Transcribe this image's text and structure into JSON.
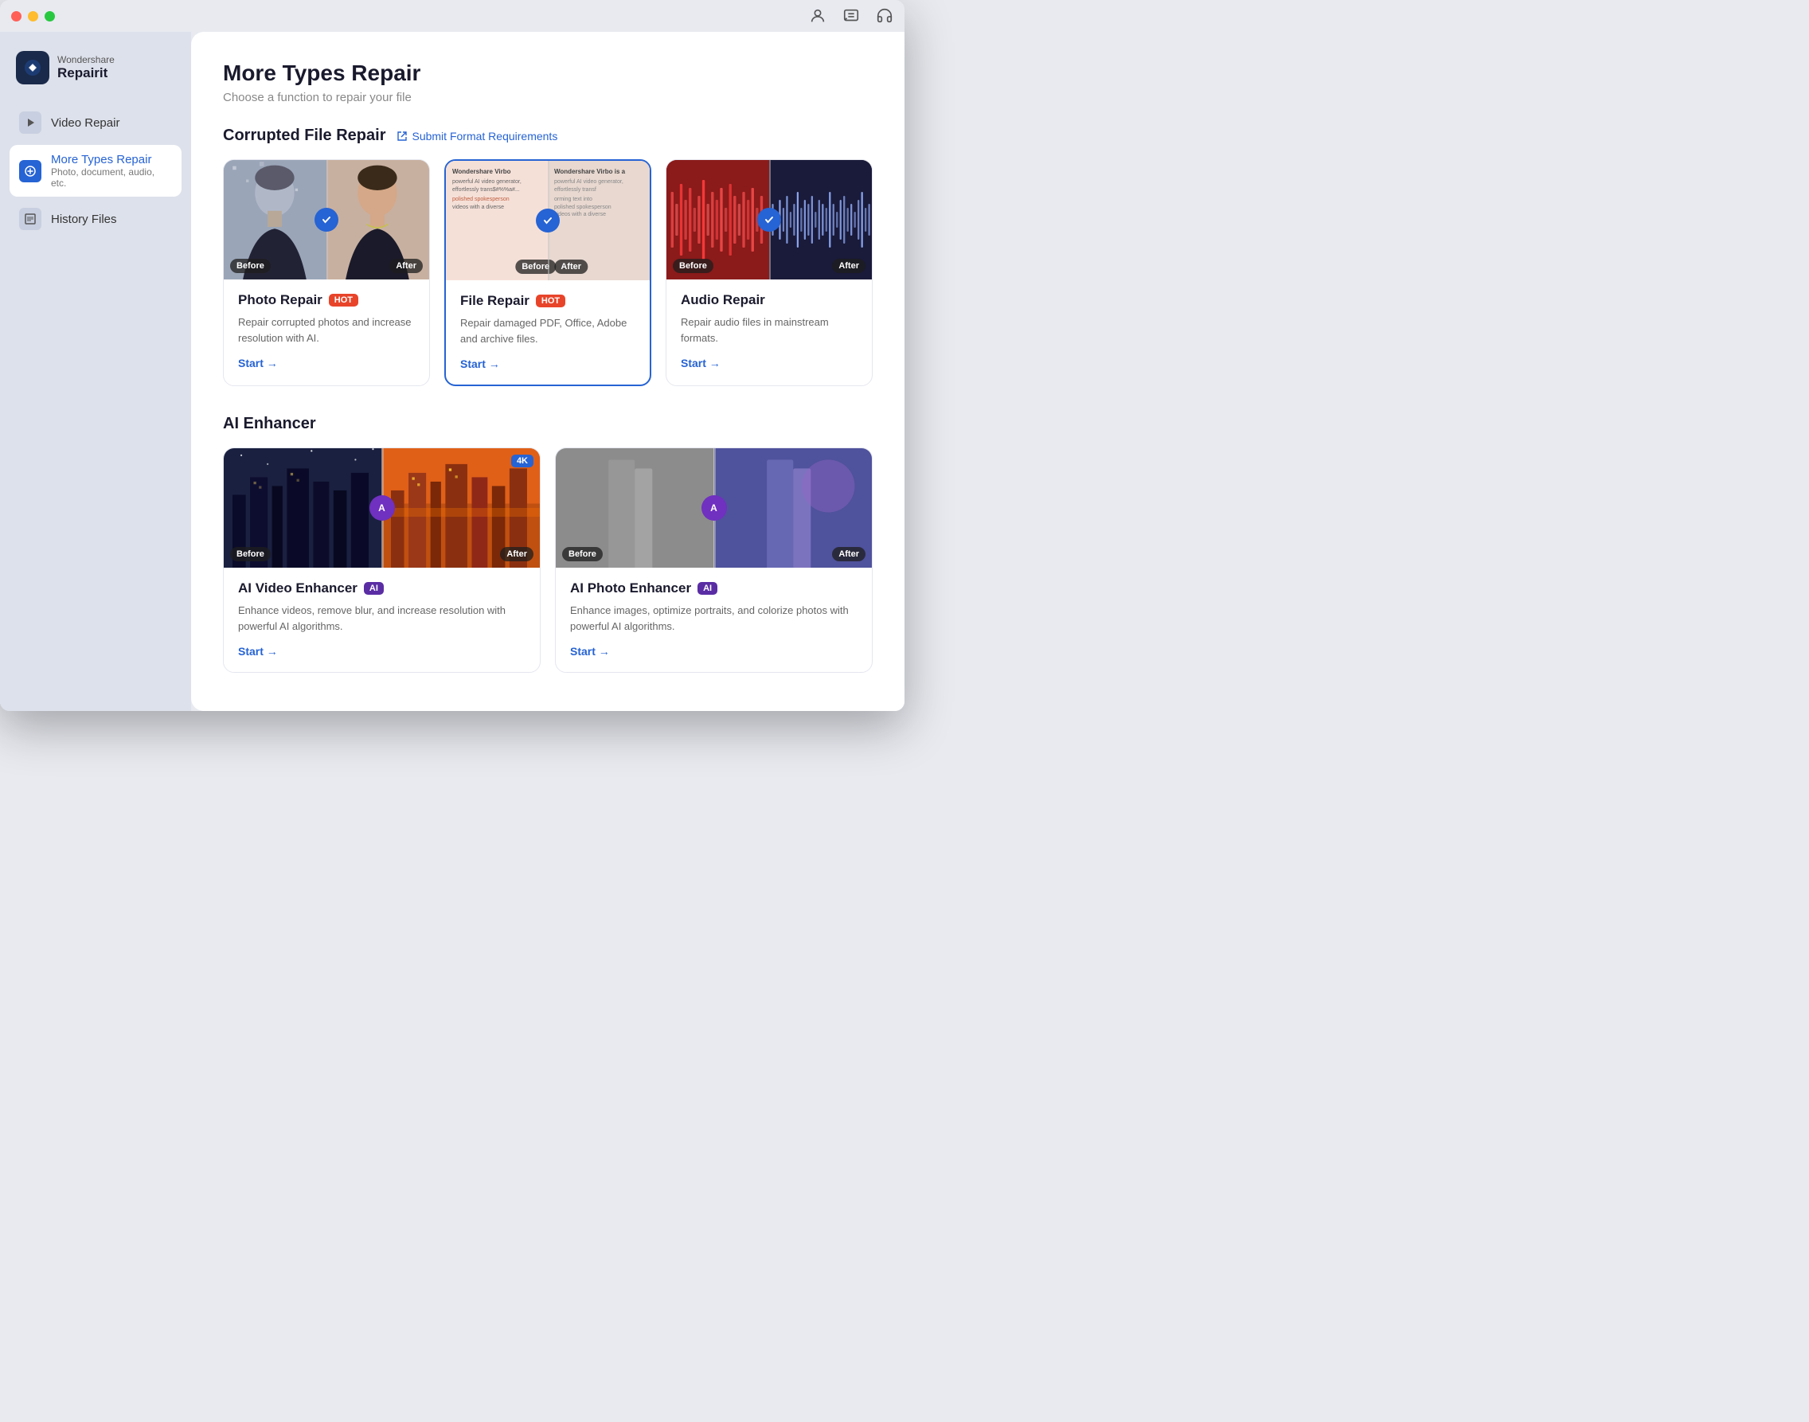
{
  "app": {
    "name": "Repairit",
    "brand": "Wondershare",
    "window_title": "Wondershare Repairit"
  },
  "titlebar": {
    "traffic_lights": [
      "red",
      "yellow",
      "green"
    ]
  },
  "sidebar": {
    "logo": {
      "brand": "Wondershare",
      "name": "Repairit"
    },
    "items": [
      {
        "id": "video-repair",
        "label": "Video Repair",
        "sub": "",
        "active": false
      },
      {
        "id": "more-types-repair",
        "label": "More Types Repair",
        "sub": "Photo, document, audio, etc.",
        "active": true
      },
      {
        "id": "history-files",
        "label": "History Files",
        "sub": "",
        "active": false
      }
    ]
  },
  "main": {
    "title": "More Types Repair",
    "subtitle": "Choose a function to repair your file",
    "sections": {
      "corrupted_file_repair": {
        "title": "Corrupted File Repair",
        "link_label": "Submit Format Requirements",
        "cards": [
          {
            "id": "photo-repair",
            "title": "Photo Repair",
            "badge": "HOT",
            "badge_type": "hot",
            "description": "Repair corrupted photos and increase resolution with AI.",
            "start_label": "Start →",
            "selected": false
          },
          {
            "id": "file-repair",
            "title": "File Repair",
            "badge": "HOT",
            "badge_type": "hot",
            "description": "Repair damaged PDF, Office, Adobe and archive files.",
            "start_label": "Start →",
            "selected": true
          },
          {
            "id": "audio-repair",
            "title": "Audio Repair",
            "badge": "",
            "badge_type": "",
            "description": "Repair audio files in mainstream formats.",
            "start_label": "Start →",
            "selected": false
          }
        ]
      },
      "ai_enhancer": {
        "title": "AI Enhancer",
        "cards": [
          {
            "id": "ai-video-enhancer",
            "title": "AI Video Enhancer",
            "badge": "AI",
            "badge_type": "ai",
            "description": "Enhance videos, remove blur, and increase resolution with powerful AI algorithms.",
            "start_label": "Start →",
            "extra_badge": "4K"
          },
          {
            "id": "ai-photo-enhancer",
            "title": "AI Photo Enhancer",
            "badge": "AI",
            "badge_type": "ai",
            "description": "Enhance images, optimize portraits, and colorize photos with powerful AI algorithms.",
            "start_label": "Start →"
          }
        ]
      }
    }
  }
}
